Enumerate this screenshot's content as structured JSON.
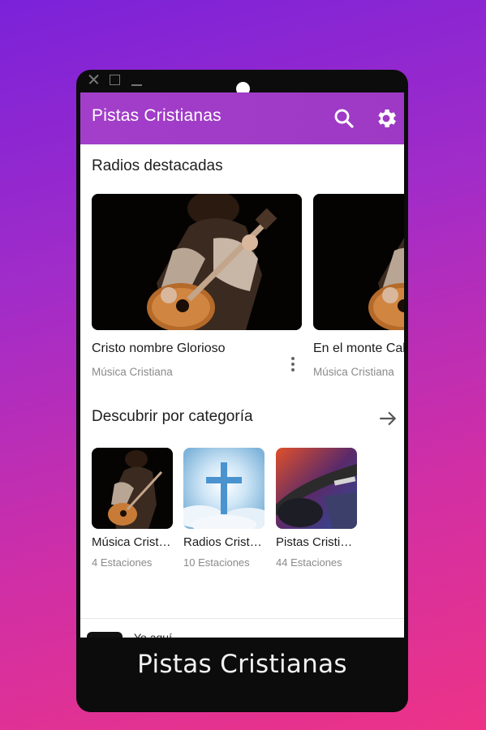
{
  "app": {
    "title": "Pistas Cristianas",
    "accent_color": "#a23ec9"
  },
  "toolbar": {
    "search_icon": "search-icon",
    "settings_icon": "gear-icon"
  },
  "featured": {
    "title": "Radios destacadas",
    "items": [
      {
        "title": "Cristo nombre Glorioso",
        "subtitle": "Música Cristiana"
      },
      {
        "title": "En el monte Calvario",
        "subtitle": "Música Cristiana"
      }
    ]
  },
  "categories": {
    "title": "Descubrir por categoría",
    "items": [
      {
        "title": "Música Cristiana",
        "count": "4 Estaciones"
      },
      {
        "title": "Radios Cristianas",
        "count": "10 Estaciones"
      },
      {
        "title": "Pistas Cristianas",
        "count": "44 Estaciones"
      }
    ]
  },
  "list_peek": {
    "text": "Yo aquí"
  },
  "caption": "Pistas Cristianas"
}
